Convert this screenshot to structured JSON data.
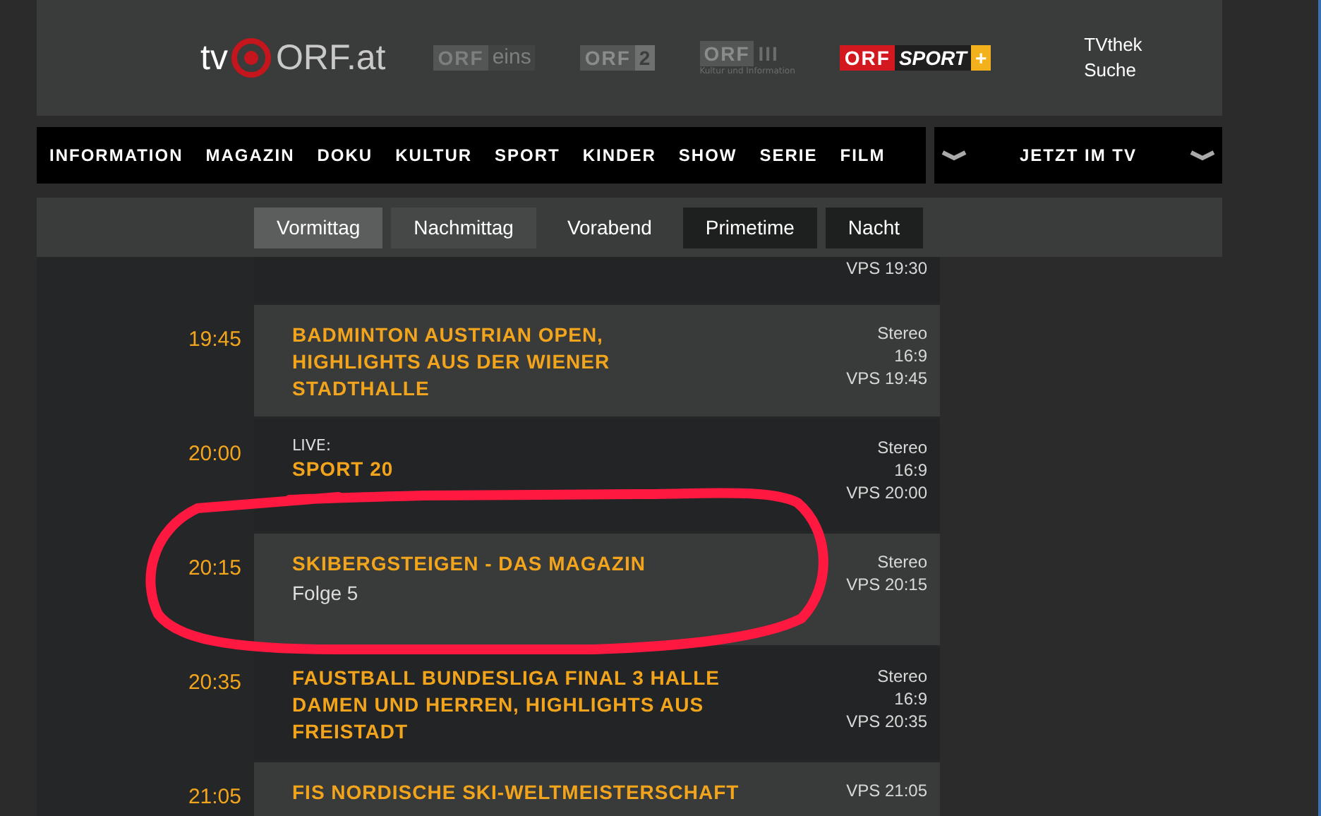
{
  "header": {
    "logo": {
      "prefix": "tv",
      "name": "ORF.at"
    },
    "channels": [
      {
        "kind": "eins",
        "brand": "ORF",
        "name": "eins"
      },
      {
        "kind": "two",
        "brand": "ORF",
        "name": "2"
      },
      {
        "kind": "three",
        "brand": "ORF",
        "name": "III",
        "tagline": "Kultur und Information"
      },
      {
        "kind": "sport",
        "brand": "ORF",
        "name": "SPORT",
        "plus": "+"
      }
    ],
    "links": [
      "TVthek",
      "Suche"
    ]
  },
  "nav": {
    "items": [
      "INFORMATION",
      "MAGAZIN",
      "DOKU",
      "KULTUR",
      "SPORT",
      "KINDER",
      "SHOW",
      "SERIE",
      "FILM"
    ],
    "dropdown": "JETZT IM TV"
  },
  "dayparts": [
    {
      "label": "Vormittag",
      "selected": true,
      "kind": "light"
    },
    {
      "label": "Nachmittag",
      "selected": false,
      "kind": "light"
    },
    {
      "label": "Vorabend",
      "selected": false,
      "kind": "plain"
    },
    {
      "label": "Primetime",
      "selected": false,
      "kind": "dark"
    },
    {
      "label": "Nacht",
      "selected": false,
      "kind": "dark"
    }
  ],
  "programs": [
    {
      "kind": "partial",
      "meta": [
        "VPS 19:30"
      ]
    },
    {
      "kind": "full",
      "time": "19:45",
      "title_lines": [
        "BADMINTON AUSTRIAN OPEN,",
        "HIGHLIGHTS AUS DER WIENER",
        "STADTHALLE"
      ],
      "meta": [
        "Stereo",
        "16:9",
        "VPS 19:45"
      ]
    },
    {
      "kind": "full",
      "time": "20:00",
      "label": "LIVE:",
      "title_lines": [
        "SPORT 20"
      ],
      "meta": [
        "Stereo",
        "16:9",
        "VPS 20:00"
      ]
    },
    {
      "kind": "full",
      "time": "20:15",
      "title_lines": [
        "SKIBERGSTEIGEN - DAS MAGAZIN"
      ],
      "subtitle": "Folge 5",
      "meta": [
        "Stereo",
        "VPS 20:15"
      ]
    },
    {
      "kind": "full",
      "time": "20:35",
      "title_lines": [
        "FAUSTBALL BUNDESLIGA FINAL 3 HALLE",
        "DAMEN UND HERREN, HIGHLIGHTS AUS",
        "FREISTADT"
      ],
      "meta": [
        "Stereo",
        "16:9",
        "VPS 20:35"
      ]
    },
    {
      "kind": "full",
      "time": "21:05",
      "title_lines": [
        "FIS NORDISCHE SKI-WELTMEISTERSCHAFT"
      ],
      "meta": [
        "VPS 21:05"
      ]
    }
  ]
}
